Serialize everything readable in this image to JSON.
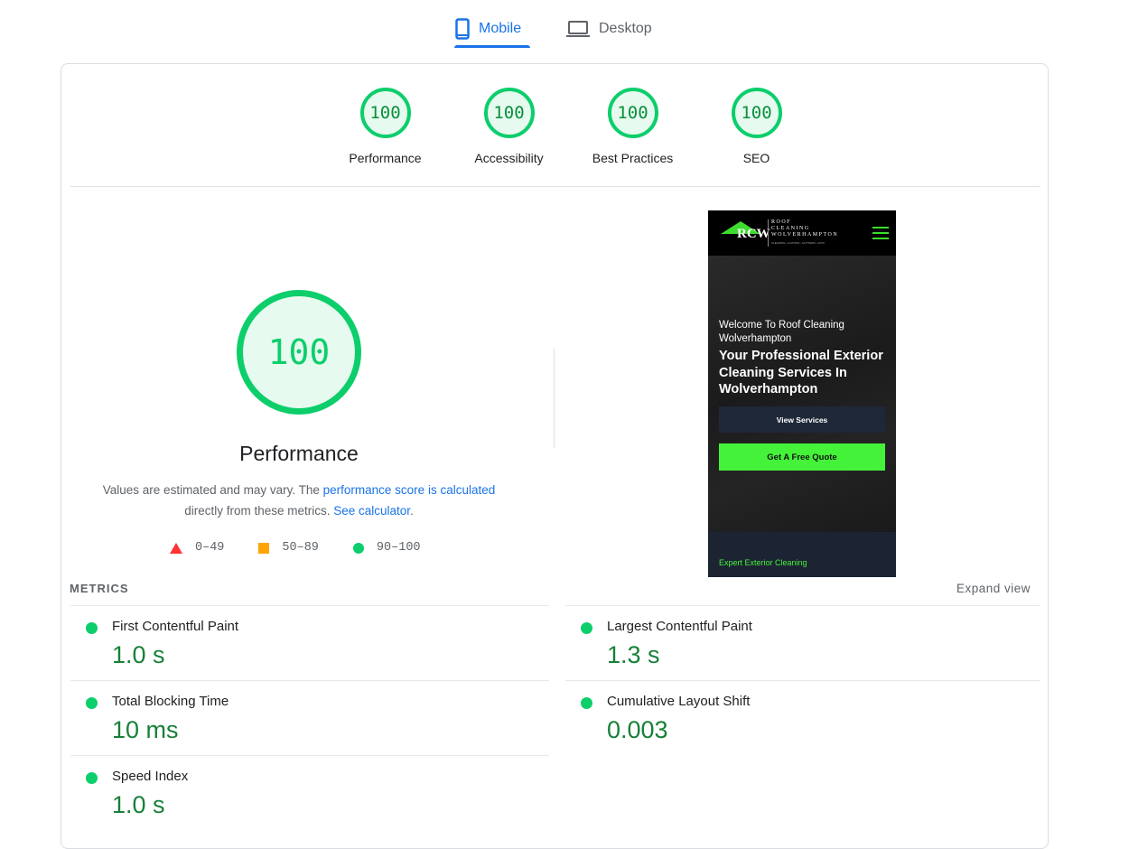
{
  "tabs": [
    {
      "label": "Mobile",
      "icon": "smartphone-icon",
      "active": true
    },
    {
      "label": "Desktop",
      "icon": "laptop-icon",
      "active": false
    }
  ],
  "categories": [
    {
      "label": "Performance",
      "score": "100"
    },
    {
      "label": "Accessibility",
      "score": "100"
    },
    {
      "label": "Best Practices",
      "score": "100"
    },
    {
      "label": "SEO",
      "score": "100"
    }
  ],
  "performance": {
    "score": "100",
    "title": "Performance",
    "desc_prefix": "Values are estimated and may vary. The ",
    "desc_link1": "performance score is calculated",
    "desc_middle": " directly from these metrics. ",
    "desc_link2": "See calculator",
    "desc_suffix": ".",
    "legend": [
      {
        "shape": "triangle",
        "range": "0–49",
        "color": "#ff3333"
      },
      {
        "shape": "square",
        "range": "50–89",
        "color": "#ffa400"
      },
      {
        "shape": "circle",
        "range": "90–100",
        "color": "#0cce6b"
      }
    ]
  },
  "screenshot": {
    "logo_mark": "RCW",
    "logo_lines": [
      "ROOF",
      "CLEANING",
      "WOLVERHAMPTON"
    ],
    "logo_tagline": "CLEANING • COATING • GUTTERS • uPVC",
    "welcome": "Welcome To Roof Cleaning Wolverhampton",
    "headline": "Your Professional Exterior Cleaning Services In Wolverhampton",
    "btn_view": "View Services",
    "btn_quote": "Get A Free Quote",
    "footer": "Expert Exterior Cleaning"
  },
  "metrics": {
    "heading": "METRICS",
    "expand_label": "Expand view",
    "items": [
      {
        "label": "First Contentful Paint",
        "value": "1.0 s",
        "status": "good"
      },
      {
        "label": "Largest Contentful Paint",
        "value": "1.3 s",
        "status": "good"
      },
      {
        "label": "Total Blocking Time",
        "value": "10 ms",
        "status": "good"
      },
      {
        "label": "Cumulative Layout Shift",
        "value": "0.003",
        "status": "good"
      },
      {
        "label": "Speed Index",
        "value": "1.0 s",
        "status": "good"
      }
    ]
  },
  "colors": {
    "pass": "#0cce6b",
    "accent": "#1a73e8",
    "metric_value": "#188038"
  }
}
